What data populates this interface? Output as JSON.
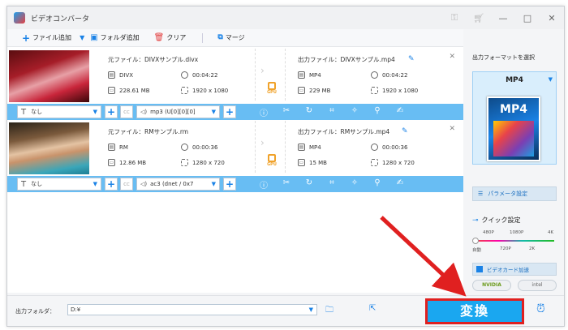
{
  "window": {
    "title": "ビデオコンバータ",
    "controls": [
      "—",
      "□",
      "✕"
    ],
    "extra_icons": [
      "key-icon",
      "cart-icon"
    ]
  },
  "toolbar": {
    "add_file": "ファイル追加",
    "add_folder": "フォルダ追加",
    "clear": "クリア",
    "merge": "マージ"
  },
  "items": [
    {
      "source_file": "元ファイル：DIVXサンプル.divx",
      "src_format": "DIVX",
      "src_duration": "00:04:22",
      "src_size": "228.61 MB",
      "src_resolution": "1920 x 1080",
      "output_file": "出力ファイル：DIVXサンプル.mp4",
      "dst_format": "MP4",
      "dst_duration": "00:04:22",
      "dst_size": "229 MB",
      "dst_resolution": "1920 x 1080",
      "subtitle": "なし",
      "audio": "mp3 (U[0][0][0]",
      "gpu_label": "GPU"
    },
    {
      "source_file": "元ファイル：RMサンプル.rm",
      "src_format": "RM",
      "src_duration": "00:00:36",
      "src_size": "12.86 MB",
      "src_resolution": "1280 x 720",
      "output_file": "出力ファイル：RMサンプル.mp4",
      "dst_format": "MP4",
      "dst_duration": "00:00:36",
      "dst_size": "15 MB",
      "dst_resolution": "1280 x 720",
      "subtitle": "なし",
      "audio": "ac3 (dnet / 0x7",
      "gpu_label": "GPU"
    }
  ],
  "sidebar": {
    "format_label": "出力フォーマットを選択",
    "format_name": "MP4",
    "format_card_label": "MP4",
    "param_button": "パラメータ設定",
    "quick_setting": "クイック設定",
    "ticks_top": [
      "480P",
      "1080P",
      "4K"
    ],
    "ticks_bottom": [
      "自動",
      "720P",
      "2K"
    ],
    "gpu_accel": "ビデオカード加速",
    "vendor_nvidia": "NVIDIA",
    "vendor_intel": "intel",
    "quality_level": 0
  },
  "footer": {
    "output_label": "出力フォルダ：",
    "output_path": "D:¥",
    "convert_button": "変換"
  },
  "colors": {
    "accent": "#1a82e6",
    "bar": "#68bdf3",
    "convert": "#1aa7f0",
    "highlight": "#e02020"
  }
}
